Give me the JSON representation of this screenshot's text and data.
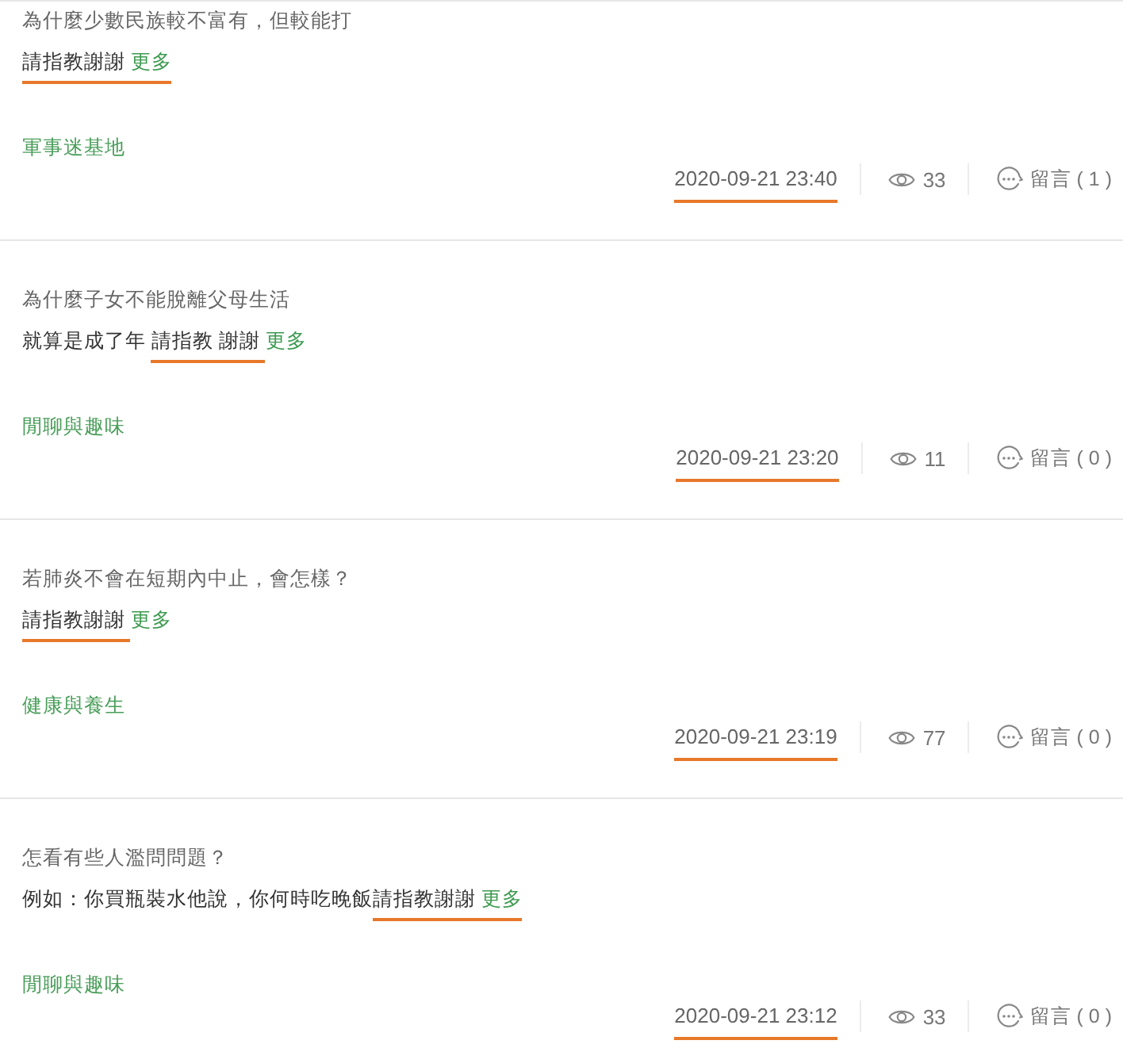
{
  "posts": [
    {
      "title": "為什麼少數民族較不富有，但較能打",
      "excerpt": [
        {
          "text": "請指教謝謝 ",
          "underlined": true
        }
      ],
      "more": {
        "label": "更多",
        "underlined": true
      },
      "category": "軍事迷基地",
      "date": {
        "text": "2020-09-21 23:40",
        "underlined": true
      },
      "views": "33",
      "comments": "留言 ( 1 )"
    },
    {
      "title": "為什麼子女不能脫離父母生活",
      "excerpt": [
        {
          "text": "就算是成了年 ",
          "underlined": false
        },
        {
          "text": "請指教 謝謝 ",
          "underlined": true
        }
      ],
      "more": {
        "label": "更多",
        "underlined": false
      },
      "category": "閒聊與趣味",
      "date": {
        "text": "2020-09-21 23:20",
        "underlined": true
      },
      "views": "11",
      "comments": "留言 ( 0 )"
    },
    {
      "title": "若肺炎不會在短期內中止，會怎樣？",
      "excerpt": [
        {
          "text": "請指教謝謝 ",
          "underlined": true
        }
      ],
      "more": {
        "label": "更多",
        "underlined": false
      },
      "category": "健康與養生",
      "date": {
        "text": "2020-09-21 23:19",
        "underlined": true
      },
      "views": "77",
      "comments": "留言 ( 0 )"
    },
    {
      "title": "怎看有些人濫問問題？",
      "excerpt": [
        {
          "text": "例如：你買瓶裝水他說，你何時吃晚飯",
          "underlined": false
        },
        {
          "text": "請指教謝謝 ",
          "underlined": true
        }
      ],
      "more": {
        "label": "更多",
        "underlined": true
      },
      "category": "閒聊與趣味",
      "date": {
        "text": "2020-09-21 23:12",
        "underlined": true
      },
      "views": "33",
      "comments": "留言 ( 0 )"
    }
  ]
}
